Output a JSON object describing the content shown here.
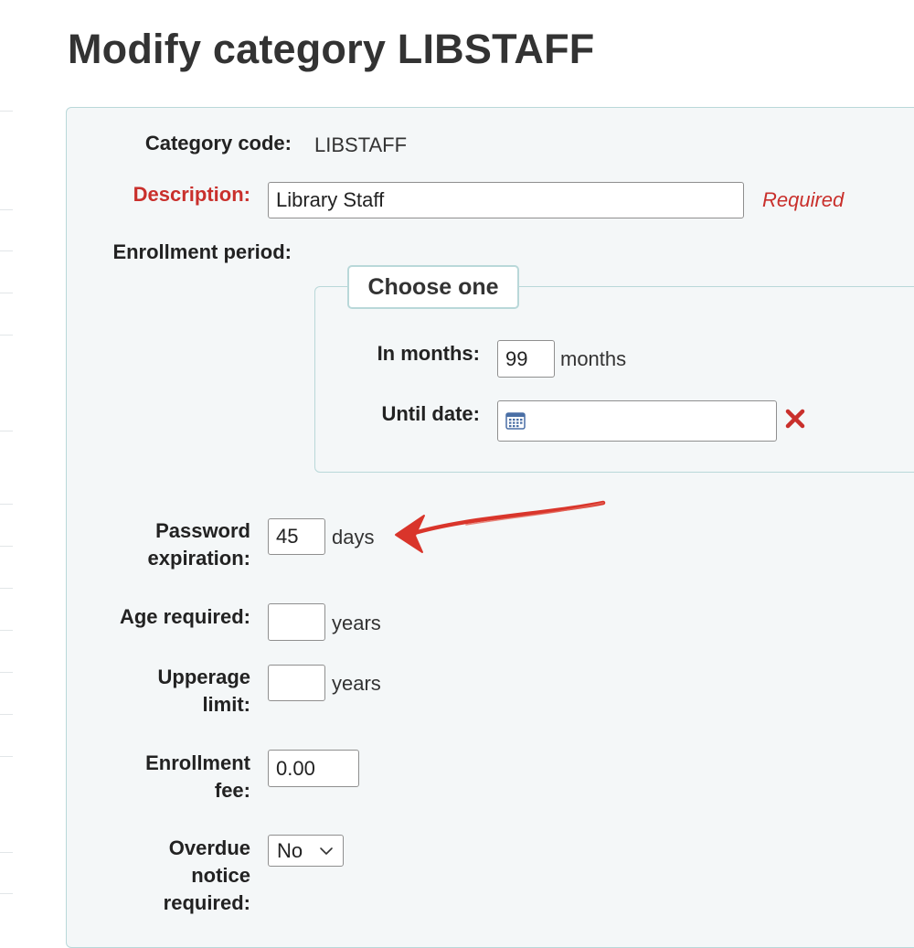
{
  "page": {
    "title": "Modify category LIBSTAFF"
  },
  "form": {
    "category_code": {
      "label": "Category code:",
      "value": "LIBSTAFF"
    },
    "description": {
      "label": "Description:",
      "value": "Library Staff",
      "required_note": "Required"
    },
    "enrollment_period": {
      "label": "Enrollment period:",
      "legend": "Choose one",
      "in_months": {
        "label": "In months:",
        "value": "99",
        "unit": "months"
      },
      "until_date": {
        "label": "Until date:",
        "value": ""
      }
    },
    "password_expiration": {
      "label_line1": "Password",
      "label_line2": "expiration:",
      "value": "45",
      "unit": "days"
    },
    "age_required": {
      "label": "Age required:",
      "value": "",
      "unit": "years"
    },
    "upperage_limit": {
      "label_line1": "Upperage",
      "label_line2": "limit:",
      "value": "",
      "unit": "years"
    },
    "enrollment_fee": {
      "label_line1": "Enrollment",
      "label_line2": "fee:",
      "value": "0.00"
    },
    "overdue_notice": {
      "label_line1": "Overdue",
      "label_line2": "notice",
      "label_line3": "required:",
      "selected": "No"
    }
  },
  "colors": {
    "required_red": "#c9302c",
    "panel_bg": "#f4f7f8",
    "panel_border": "#b9d8d9",
    "annotation_arrow": "#d9352b",
    "calendar_blue": "#4a6fa5"
  },
  "icons": {
    "calendar": "calendar-icon",
    "clear": "close-icon",
    "select_chevron": "chevron-down-icon",
    "annotation": "arrow-annotation"
  }
}
